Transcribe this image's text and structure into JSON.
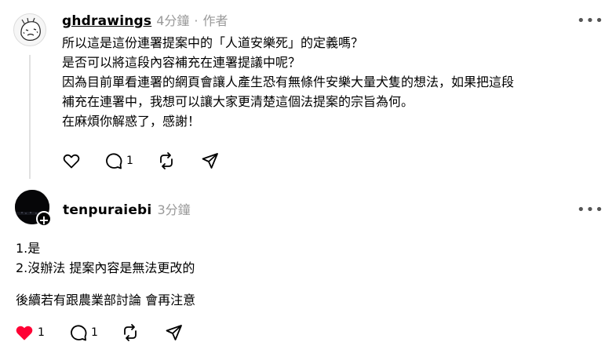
{
  "comment1": {
    "username": "ghdrawings",
    "time": "4分鐘",
    "separator": "·",
    "role": "作者",
    "lines": [
      "所以這是這份連署提案中的「人道安樂死」的定義嗎？",
      "是否可以將這段內容補充在連署提議中呢？",
      "因為目前單看連署的網頁會讓人產生恐有無條件安樂大量犬隻的想法，如果把這段",
      "補充在連署中，我想可以讓大家更清楚這個法提案的宗旨為何。",
      "在麻煩你解惑了，感謝！"
    ],
    "reply_count": "1",
    "more": "•••"
  },
  "comment2": {
    "username": "tenpuraiebi",
    "time": "3分鐘",
    "paragraphs": [
      "1.是",
      "2.沒辦法 提案內容是無法更改的",
      "後續若有跟農業部討論 會再注意"
    ],
    "like_count": "1",
    "reply_count": "1",
    "more": "•••",
    "plus": "+"
  },
  "colors": {
    "like_active": "#ff0034",
    "muted": "#999999",
    "line": "#e1e1e1"
  }
}
